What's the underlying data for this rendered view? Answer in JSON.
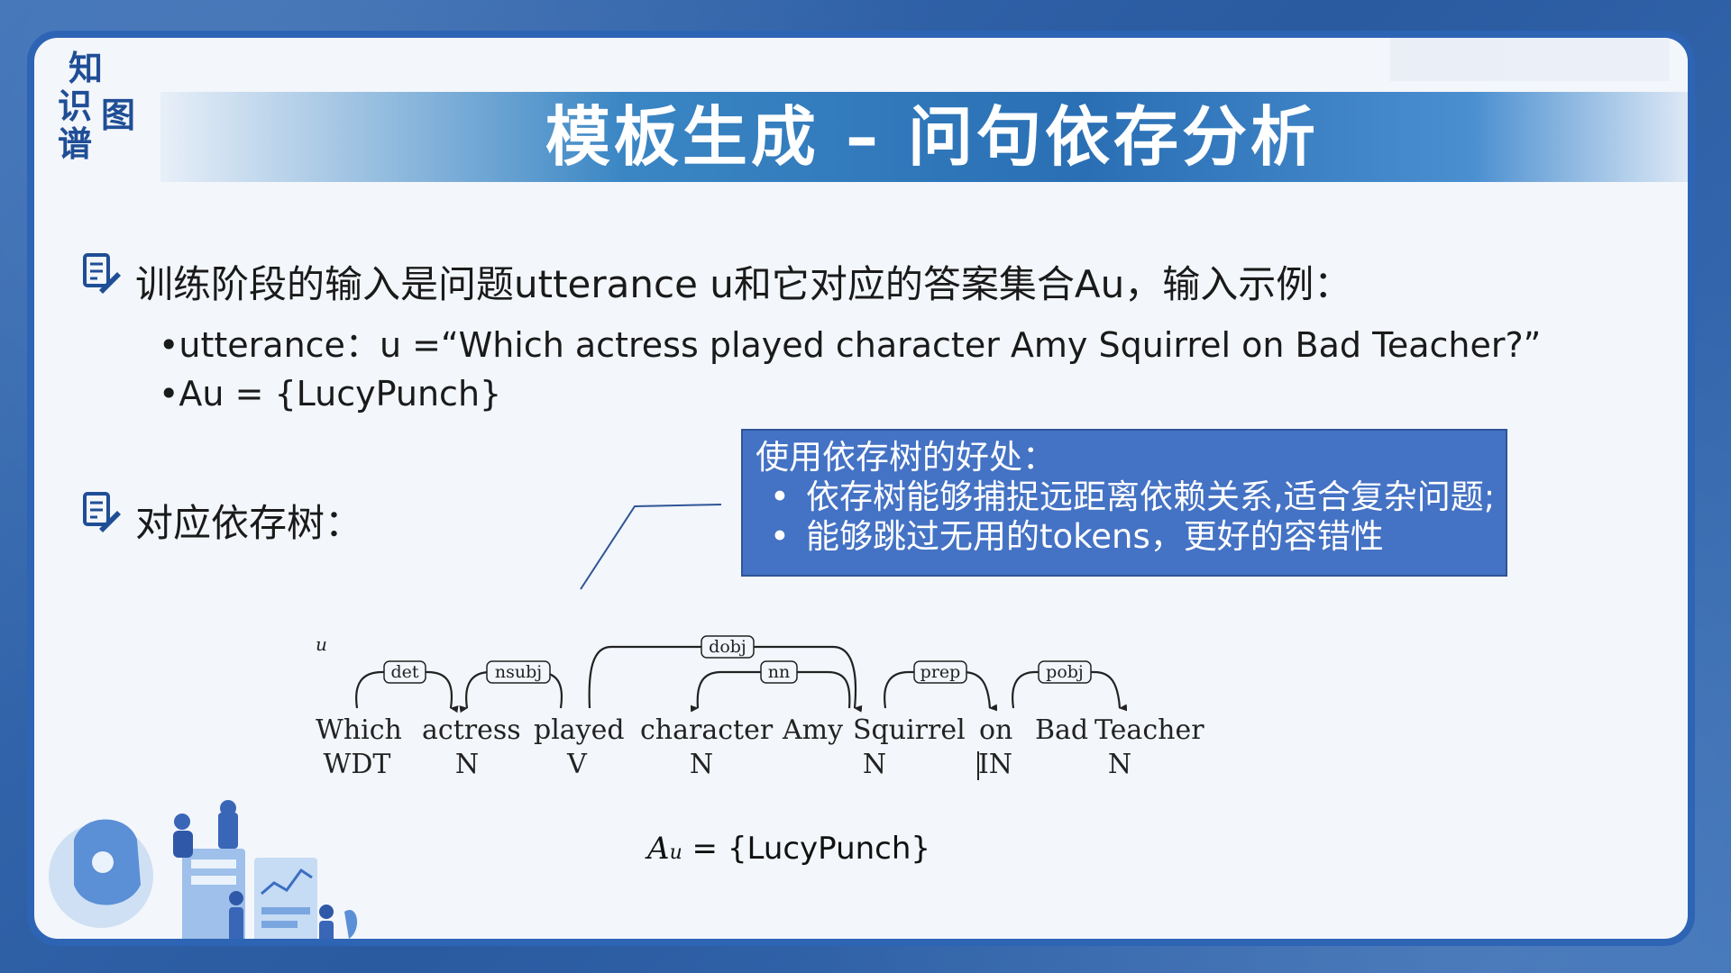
{
  "logo": {
    "c1": "知",
    "c2": "识",
    "c3": "图",
    "c4": "谱"
  },
  "title": "模板生成 – 问句依存分析",
  "bullet1": {
    "text": "训练阶段的输入是问题utterance u和它对应的答案集合Au，输入示例：",
    "sub1": "•utterance：u =“Which actress played character Amy Squirrel on Bad Teacher?”",
    "sub2": "•Au = {LucyPunch}"
  },
  "bullet2": {
    "text": "对应依存树："
  },
  "callout": {
    "title": "使用依存树的好处：",
    "items": [
      "依存树能够捕捉远距离依赖关系,适合复杂问题;",
      "能够跳过无用的tokens，更好的容错性"
    ],
    "dot": "•"
  },
  "dependency_tree": {
    "label_u": "u",
    "words": [
      "Which",
      "actress",
      "played",
      "character",
      "Amy",
      "Squirrel",
      "on",
      "Bad",
      "Teacher"
    ],
    "tags": [
      "WDT",
      "N",
      "V",
      "N",
      "N",
      "IN",
      "N"
    ],
    "arcs": [
      "det",
      "nsubj",
      "dobj",
      "nn",
      "prep",
      "pobj"
    ]
  },
  "answer": {
    "lhs": "A",
    "sub": "u",
    "rhs": "= {LucyPunch}"
  },
  "colors": {
    "accent": "#2e64b4",
    "callout_bg": "#4472c4",
    "slide_bg": "#f3f6fb"
  }
}
